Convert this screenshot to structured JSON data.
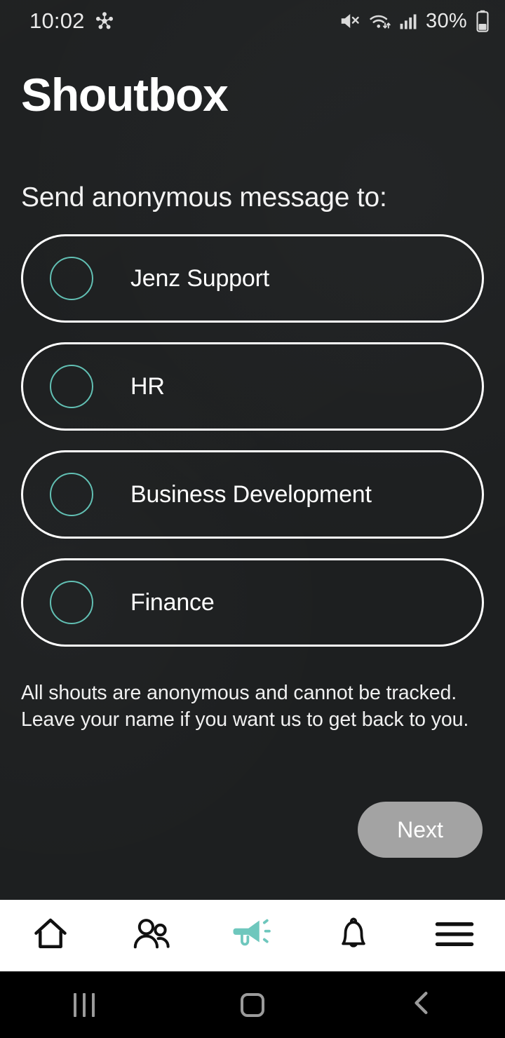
{
  "status_bar": {
    "time": "10:02",
    "left_icon": "smart-view-icon",
    "icons": [
      "mute-icon",
      "wifi-icon",
      "cellular-signal-icon"
    ],
    "battery_percent": "30%",
    "battery_icon": "battery-icon"
  },
  "header": {
    "app_title": "Shoutbox"
  },
  "main": {
    "prompt": "Send anonymous message to:",
    "recipients": [
      {
        "label": "Jenz Support",
        "selected": false
      },
      {
        "label": "HR",
        "selected": false
      },
      {
        "label": "Business Development",
        "selected": false
      },
      {
        "label": "Finance",
        "selected": false
      }
    ],
    "disclaimer_line1": "All shouts are anonymous and cannot be tracked.",
    "disclaimer_line2": "Leave your name if you want us to get back to you.",
    "next_label": "Next"
  },
  "tab_bar": {
    "items": [
      {
        "name": "home",
        "icon": "home-icon",
        "active": false
      },
      {
        "name": "people",
        "icon": "people-icon",
        "active": false
      },
      {
        "name": "shoutbox",
        "icon": "megaphone-icon",
        "active": true
      },
      {
        "name": "notifications",
        "icon": "bell-icon",
        "active": false
      },
      {
        "name": "menu",
        "icon": "hamburger-menu-icon",
        "active": false
      }
    ]
  },
  "android_nav": {
    "recents": "recents-icon",
    "home": "home-icon",
    "back": "back-icon"
  },
  "colors": {
    "background": "#1d1f20",
    "accent_teal": "#6ec7bd",
    "radio_outline": "#62c0b4",
    "text_primary": "#ffffff",
    "next_button": "#a3a3a3",
    "tab_bar_background": "#ffffff",
    "android_nav_background": "#000000"
  }
}
